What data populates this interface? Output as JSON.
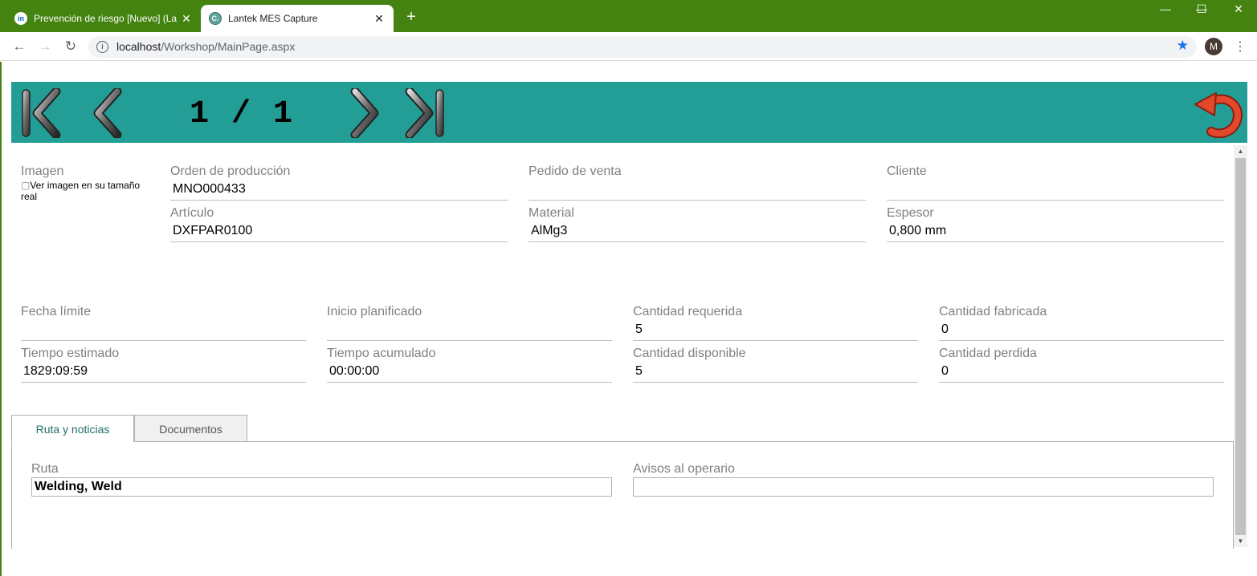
{
  "browser": {
    "tabs": [
      {
        "favicon": "in",
        "title": "Prevención de riesgo [Nuevo] (La",
        "active": false
      },
      {
        "favicon": "C.",
        "title": "Lantek MES Capture",
        "active": true
      }
    ],
    "new_tab_label": "+",
    "window_controls": {
      "minimize": "—",
      "maximize": "☐",
      "close": "✕"
    },
    "address": {
      "host": "localhost",
      "path": "/Workshop/MainPage.aspx"
    },
    "profile_initial": "M"
  },
  "toolbar": {
    "pager": "1 / 1",
    "icons": [
      "first-page-icon",
      "previous-page-icon",
      "next-page-icon",
      "last-page-icon",
      "undo-icon"
    ],
    "accent_color": "#229e96"
  },
  "order": {
    "image_label": "Imagen",
    "image_alt": "Ver imagen en su tamaño real",
    "fields": {
      "orden": {
        "label": "Orden de producción",
        "value": "MNO000433"
      },
      "pedido": {
        "label": "Pedido de venta",
        "value": ""
      },
      "cliente": {
        "label": "Cliente",
        "value": ""
      },
      "articulo": {
        "label": "Artículo",
        "value": "DXFPAR0100"
      },
      "material": {
        "label": "Material",
        "value": "AlMg3"
      },
      "espesor": {
        "label": "Espesor",
        "value": "0,800 mm"
      },
      "fecha_limite": {
        "label": "Fecha límite",
        "value": ""
      },
      "inicio_planificado": {
        "label": "Inicio planificado",
        "value": ""
      },
      "cantidad_requerida": {
        "label": "Cantidad requerida",
        "value": "5"
      },
      "cantidad_fabricada": {
        "label": "Cantidad fabricada",
        "value": "0"
      },
      "tiempo_estimado": {
        "label": "Tiempo estimado",
        "value": "1829:09:59"
      },
      "tiempo_acumulado": {
        "label": "Tiempo acumulado",
        "value": "00:00:00"
      },
      "cantidad_disponible": {
        "label": "Cantidad disponible",
        "value": "5"
      },
      "cantidad_perdida": {
        "label": "Cantidad perdida",
        "value": "0"
      }
    }
  },
  "detail_tabs": [
    {
      "label": "Ruta y noticias",
      "active": true
    },
    {
      "label": "Documentos",
      "active": false
    }
  ],
  "route_panel": {
    "ruta_label": "Ruta",
    "ruta_value": "Welding, Weld",
    "avisos_label": "Avisos al operario",
    "avisos_value": ""
  }
}
